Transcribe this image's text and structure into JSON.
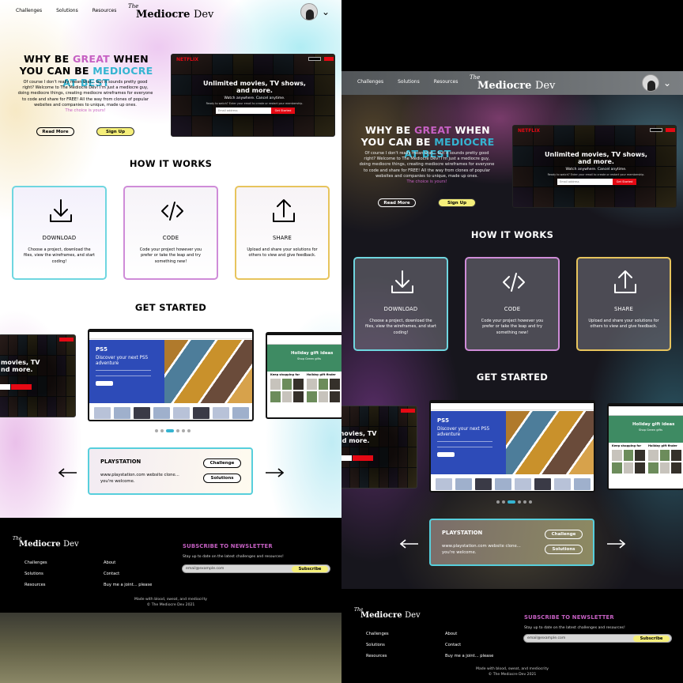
{
  "nav": {
    "links": [
      "Challenges",
      "Solutions",
      "Resources"
    ],
    "logo_the": "The",
    "logo_bold": "Mediocre",
    "logo_light": "Dev"
  },
  "hero": {
    "title_1": "WHY BE ",
    "title_great": "GREAT",
    "title_2": " WHEN YOU CAN BE ",
    "title_mediocre": "MEDIOCRE AT BEST",
    "body": "Of course I don't really mean that... but it sounds pretty good right? Welcome to The Mediocre Dev! I'm just a mediocre guy, doing mediocre things, creating mediocre wireframes for everyone to code and share for FREE! All the way from clones of popular websites and companies to unique, made up ones.",
    "accent": "The choice is yours!",
    "read_more": "Read More",
    "sign_up": "Sign Up"
  },
  "netflix_preview": {
    "logo": "NETFLIX",
    "headline": "Unlimited movies, TV shows, and more.",
    "subline": "Watch anywhere. Cancel anytime.",
    "desc": "Ready to watch? Enter your email to create or restart your membership.",
    "email_placeholder": "Email address",
    "cta": "Get Started"
  },
  "how_it_works": {
    "title": "HOW IT WORKS",
    "cards": [
      {
        "icon": "download-icon",
        "title": "DOWNLOAD",
        "desc": "Choose a project, download the files, view the wireframes, and start coding!"
      },
      {
        "icon": "code-icon",
        "title": "CODE",
        "desc": "Code your project however you prefer or take the leap and try something new!"
      },
      {
        "icon": "share-icon",
        "title": "SHARE",
        "desc": "Upload and share your solutions for others to view and give feedback."
      }
    ]
  },
  "get_started": {
    "title": "GET STARTED",
    "ps_logo": "PS5",
    "ps_headline": "Discover your next PS5 adventure",
    "gs_title": "Holiday gift ideas",
    "gs_sub": "Shop Green gifts",
    "gs_col1": "Keep shopping for",
    "gs_col2": "Holiday gift finder",
    "netflix_clip": "movies, TV\nnd more.",
    "carousel_count": 6,
    "carousel_active": 2
  },
  "project_card": {
    "title": "PLAYSTATION",
    "desc": "www.playstation.com website clone... you're welcome.",
    "challenge": "Challenge",
    "solutions": "Solutions"
  },
  "footer": {
    "links_col1": [
      "Challenges",
      "Solutions",
      "Resources"
    ],
    "links_col2": [
      "About",
      "Contact",
      "Buy me a joint... please"
    ],
    "newsletter_title": "SUBSCRIBE TO NEWSLETTER",
    "newsletter_note": "Stay up to date on the latest challenges and resources!",
    "email_placeholder": "email@example.com",
    "subscribe": "Subscribe",
    "made_with": "Made with blood, sweat, and mediocrity",
    "copyright": "© The Mediocre Dev 2021"
  },
  "colors": {
    "pink": "#c660c3",
    "cyan": "#35b4d1",
    "yellow": "#f5ef7a",
    "netflix_red": "#e50914",
    "ps_blue": "#2d4bb8"
  }
}
